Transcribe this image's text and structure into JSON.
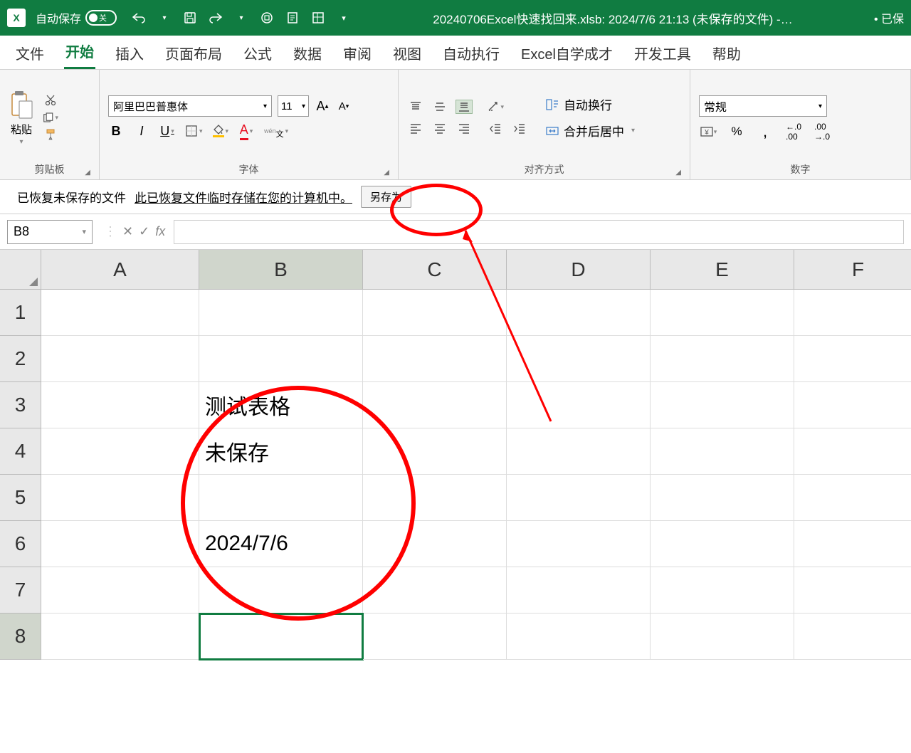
{
  "titlebar": {
    "autosave_label": "自动保存",
    "toggle_state": "关",
    "filename": "20240706Excel快速找回来.xlsb: 2024/7/6 21:13 (未保存的文件) -…",
    "saved_indicator": "• 已保"
  },
  "tabs": {
    "items": [
      "文件",
      "开始",
      "插入",
      "页面布局",
      "公式",
      "数据",
      "审阅",
      "视图",
      "自动执行",
      "Excel自学成才",
      "开发工具",
      "帮助"
    ],
    "active_index": 1
  },
  "ribbon": {
    "clipboard": {
      "paste": "粘贴",
      "label": "剪贴板"
    },
    "font": {
      "name": "阿里巴巴普惠体",
      "size": "11",
      "label": "字体",
      "bold": "B",
      "italic": "I",
      "underline": "U",
      "phonetic": "wén\n文"
    },
    "align": {
      "wrap": "自动换行",
      "merge": "合并后居中",
      "label": "对齐方式"
    },
    "number": {
      "format": "常规",
      "label": "数字"
    }
  },
  "infobar": {
    "recovered": "已恢复未保存的文件",
    "stored": "此已恢复文件临时存储在您的计算机中。",
    "saveas": "另存为"
  },
  "namebox": {
    "ref": "B8",
    "fx": "fx"
  },
  "grid": {
    "cols": [
      "A",
      "B",
      "C",
      "D",
      "E",
      "F"
    ],
    "rows": [
      "1",
      "2",
      "3",
      "4",
      "5",
      "6",
      "7",
      "8"
    ],
    "active_col": 1,
    "active_row": 7,
    "data": {
      "B3": "测试表格",
      "B4": "未保存",
      "B6": "2024/7/6"
    }
  }
}
